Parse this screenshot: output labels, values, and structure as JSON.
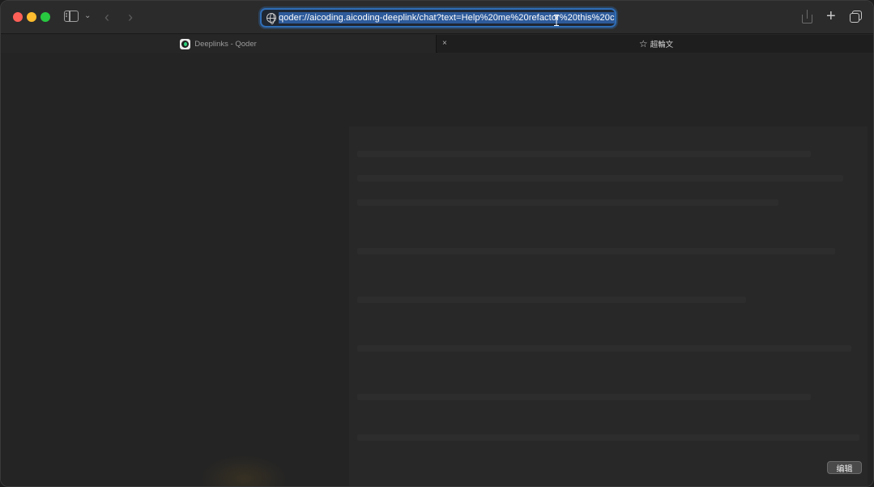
{
  "toolbar": {
    "url": "qoder://aicoding.aicoding-deeplink/chat?text=Help%20me%20refactor%20this%20c",
    "icons": {
      "sidebar": "sidebar-toggle-icon",
      "back": "chevron-left-icon",
      "forward": "chevron-right-icon",
      "share": "share-icon",
      "new_tab": "plus-icon",
      "tab_overview": "tab-overview-icon"
    },
    "glyphs": {
      "chevron_down": "⌄",
      "back": "‹",
      "forward": "›",
      "plus": "+"
    }
  },
  "tabs": [
    {
      "title": "Deeplinks - Qoder",
      "active": true
    },
    {
      "title": "超輪文",
      "active": false
    }
  ],
  "tab_glyphs": {
    "close": "×",
    "star": "☆"
  },
  "content": {
    "edit_button_label": "编辑"
  },
  "colors": {
    "url_focus_ring": "#2f6db5",
    "url_selection": "#2d5a9a",
    "close": "#fe5f57",
    "minimize": "#febc2e",
    "zoom": "#28c840"
  }
}
